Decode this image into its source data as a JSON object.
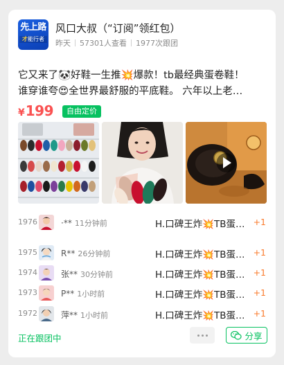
{
  "header": {
    "logo": {
      "line1": "先上路",
      "line2_accent": "才",
      "line2_rest": "能行者"
    },
    "title": "风口大叔（“订阅”领红包）",
    "meta": {
      "period": "昨天",
      "views": "57301人查看",
      "follows": "1977次跟团"
    }
  },
  "post": {
    "line1": "它又来了🐼好鞋一生推💥爆款！tb最经典蛋卷鞋！",
    "line2": "谁穿谁夸😍全世界最舒服的平底鞋。 六年以上老…",
    "price": {
      "currency": "¥",
      "amount": "199"
    },
    "price_tag": "自由定价"
  },
  "photos": [
    {
      "alt": "flat shoes display"
    },
    {
      "alt": "girl holding flats"
    },
    {
      "alt": "shoe video",
      "icon": "play-icon"
    }
  ],
  "orders": [
    {
      "num": "1976",
      "name": "·**",
      "time": "11分钟前",
      "item": "H.口碑王炸💥TB蛋…",
      "qty": "+1"
    },
    {
      "num": "1975",
      "name": "R**",
      "time": "26分钟前",
      "item": "H.口碑王炸💥TB蛋…",
      "qty": "+1"
    },
    {
      "num": "1974",
      "name": "张**",
      "time": "30分钟前",
      "item": "H.口碑王炸💥TB蛋…",
      "qty": "+1"
    },
    {
      "num": "1973",
      "name": "P**",
      "time": "1小时前",
      "item": "H.口碑王炸💥TB蛋…",
      "qty": "+1"
    },
    {
      "num": "1972",
      "name": "萍**",
      "time": "1小时前",
      "item": "H.口碑王炸💥TB蛋…",
      "qty": "+1"
    }
  ],
  "footer": {
    "following": "正在跟团中",
    "share": "分享"
  },
  "colors": {
    "brand_green": "#07c160",
    "price_red": "#fa5151",
    "plus_orange": "#fa7a2b"
  }
}
